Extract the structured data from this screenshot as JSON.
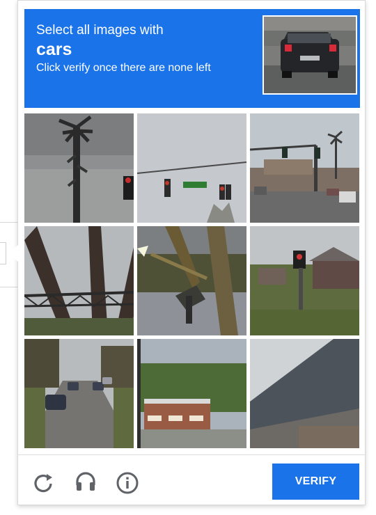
{
  "header": {
    "instruction": "Select all images with",
    "target": "cars",
    "hint": "Click verify once there are none left"
  },
  "footer": {
    "verify_label": "VERIFY",
    "reload_icon": "reload-icon",
    "audio_icon": "headphones-icon",
    "info_icon": "info-icon"
  },
  "colors": {
    "accent": "#1a73e8",
    "icon": "#5f6368"
  }
}
